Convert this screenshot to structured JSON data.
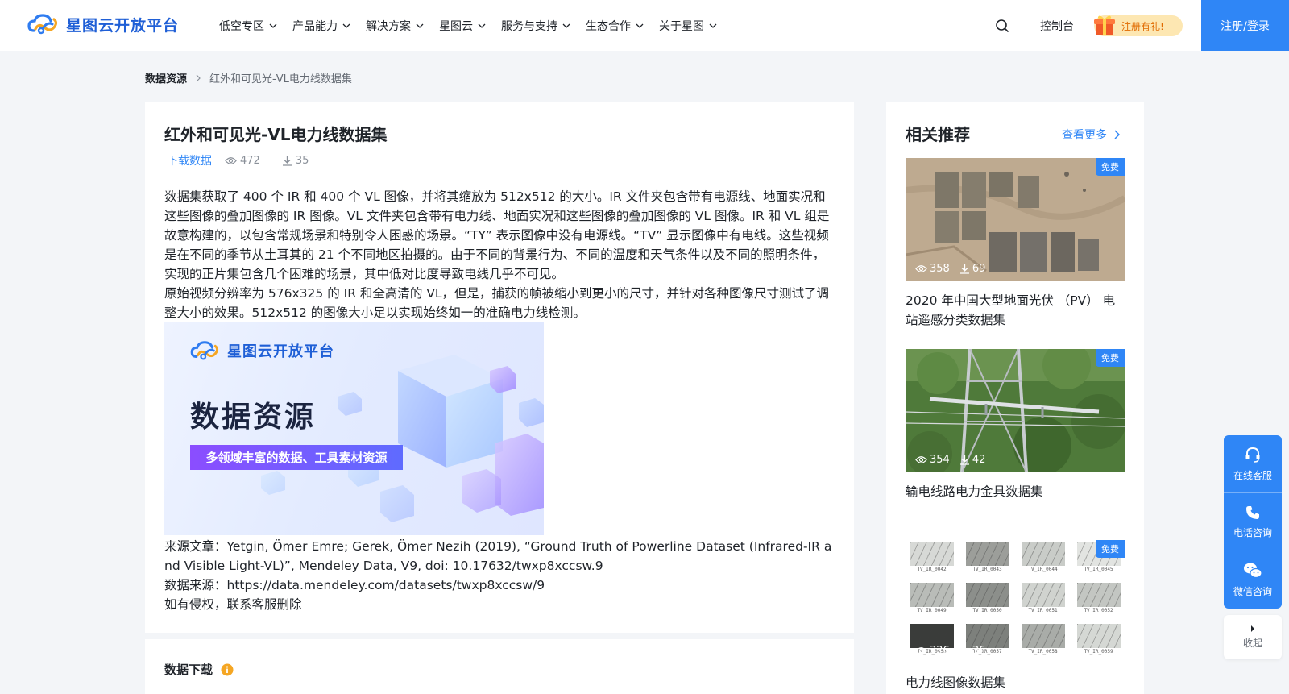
{
  "header": {
    "logo_text": "星图云开放平台",
    "nav": [
      {
        "label": "低空专区"
      },
      {
        "label": "产品能力"
      },
      {
        "label": "解决方案"
      },
      {
        "label": "星图云"
      },
      {
        "label": "服务与支持"
      },
      {
        "label": "生态合作"
      },
      {
        "label": "关于星图"
      }
    ],
    "console": "控制台",
    "gift": "注册有礼!",
    "login": "注册/登录"
  },
  "breadcrumb": {
    "root": "数据资源",
    "current": "红外和可见光-VL电力线数据集"
  },
  "dataset": {
    "title": "红外和可见光-VL电力线数据集",
    "download_link": "下载数据",
    "views": "472",
    "downloads": "35",
    "description": [
      "数据集获取了 400 个 IR 和 400 个 VL 图像，并将其缩放为 512x512 的大小。IR 文件夹包含带有电源线、地面实况和这些图像的叠加图像的 IR 图像。VL 文件夹包含带有电力线、地面实况和这些图像的叠加图像的 VL 图像。IR 和 VL 组是故意构建的，以包含常规场景和特别令人困惑的场景。“TY” 表示图像中没有电源线。“TV” 显示图像中有电线。这些视频是在不同的季节从土耳其的 21 个不同地区拍摄的。由于不同的背景行为、不同的温度和天气条件以及不同的照明条件，实现的正片集包含几个困难的场景，其中低对比度导致电线几乎不可见。",
      "原始视频分辨率为 576x325 的 IR 和全高清的 VL，但是，捕获的帧被缩小到更小的尺寸，并针对各种图像尺寸测试了调整大小的效果。512x512 的图像大小足以实现始终如一的准确电力线检测。"
    ],
    "banner": {
      "logo_text": "星图云开放平台",
      "title": "数据资源",
      "subtitle": "多领域丰富的数据、工具素材资源"
    },
    "source_article": "来源文章：Yetgin, Ömer Emre; Gerek, Ömer Nezih (2019), “Ground Truth of Powerline Dataset (Infrared-IR and Visible Light-VL)”, Mendeley Data, V9, doi: 10.17632/twxp8xccsw.9",
    "data_source": "数据来源：https://data.mendeley.com/datasets/twxp8xccsw/9",
    "notice": "如有侵权，联系客服删除",
    "download_section_title": "数据下载"
  },
  "sidebar": {
    "title": "相关推荐",
    "more": "查看更多",
    "items": [
      {
        "badge": "免费",
        "views": "358",
        "downloads": "69",
        "title": "2020 年中国大型地面光伏 （PV） 电站遥感分类数据集"
      },
      {
        "badge": "免费",
        "views": "354",
        "downloads": "42",
        "title": "输电线路电力金具数据集"
      },
      {
        "badge": "免费",
        "views": "326",
        "downloads": "36",
        "title": "电力线图像数据集"
      }
    ],
    "thumb_labels": [
      "TV_IR_0042",
      "TV_IR_0043",
      "TV_IR_0044",
      "TV_IR_0045",
      "TV_IR_0049",
      "TV_IR_0050",
      "TV_IR_0051",
      "TV_IR_0052",
      "TV_IR_0056",
      "TV_IR_0057",
      "TV_IR_0058",
      "TV_IR_0059"
    ]
  },
  "float_bar": {
    "online": "在线客服",
    "phone": "电话咨询",
    "wechat": "微信咨询",
    "collapse": "收起"
  },
  "colors": {
    "primary": "#2f86f6",
    "background": "#f3f5f8",
    "gift_bg": "#fde7b2",
    "gift_text": "#e06a00"
  }
}
